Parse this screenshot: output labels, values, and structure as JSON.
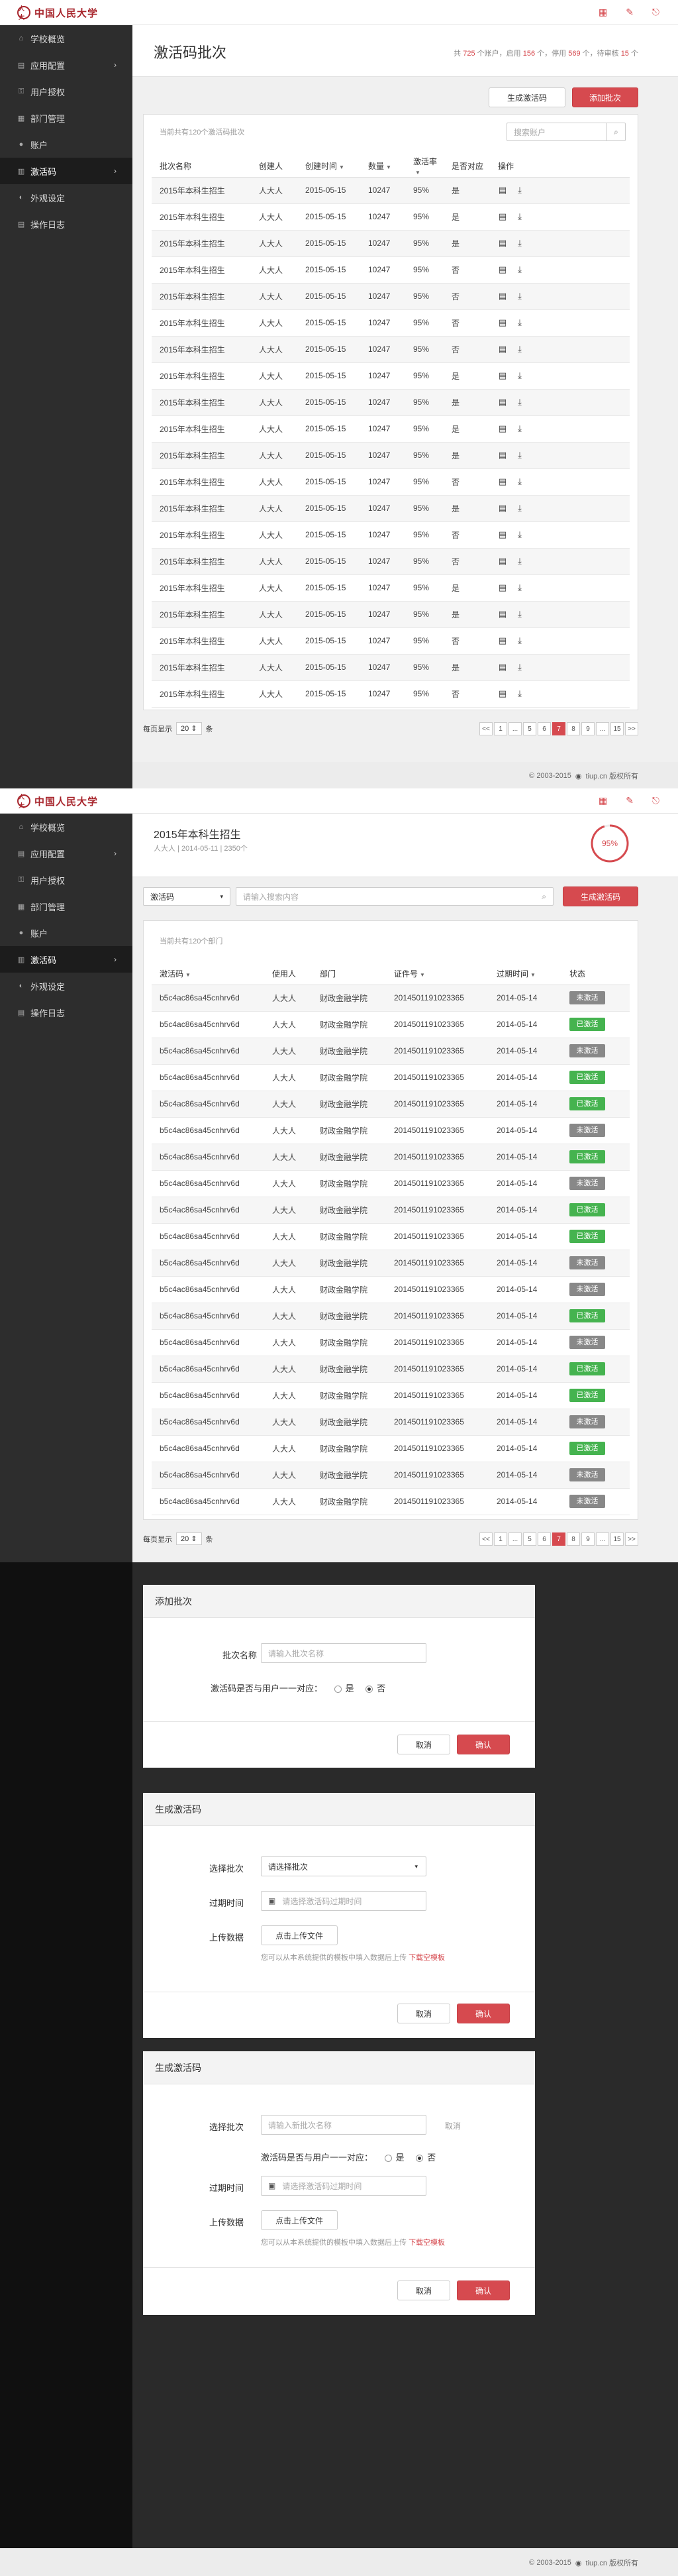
{
  "brand": {
    "seal": "人大",
    "name": "中国人民大学"
  },
  "header_icons": [
    "grid-icon",
    "user-icon",
    "logout-icon"
  ],
  "sidebar": {
    "items": [
      {
        "label": "学校概览",
        "icon": "home-icon"
      },
      {
        "label": "应用配置",
        "icon": "app-icon",
        "chev": "›"
      },
      {
        "label": "用户授权",
        "icon": "key-icon"
      },
      {
        "label": "部门管理",
        "icon": "org-icon"
      },
      {
        "label": "账户",
        "icon": "account-icon"
      },
      {
        "label": "激活码",
        "icon": "code-icon",
        "chev": "›",
        "active": true
      },
      {
        "label": "外观设定",
        "icon": "appearance-icon"
      },
      {
        "label": "操作日志",
        "icon": "log-icon"
      }
    ]
  },
  "page1": {
    "title": "激活码批次",
    "stats": {
      "p1": "共",
      "n1": "725",
      "p2": "个账户，启用",
      "n2": "156",
      "p3": "个，停用",
      "n3": "569",
      "p4": "个，待审核",
      "n4": "15",
      "p5": "个"
    },
    "btn_generate": "生成激活码",
    "btn_add": "添加批次",
    "summary": "当前共有120个激活码批次",
    "search_placeholder": "搜索账户",
    "columns": [
      "批次名称",
      "创建人",
      "创建时间",
      "数量",
      "激活率",
      "是否对应",
      "操作"
    ],
    "rows": [
      [
        "2015年本科生招生",
        "人大人",
        "2015-05-15",
        "10247",
        "95%",
        "是"
      ],
      [
        "2015年本科生招生",
        "人大人",
        "2015-05-15",
        "10247",
        "95%",
        "是"
      ],
      [
        "2015年本科生招生",
        "人大人",
        "2015-05-15",
        "10247",
        "95%",
        "是"
      ],
      [
        "2015年本科生招生",
        "人大人",
        "2015-05-15",
        "10247",
        "95%",
        "否"
      ],
      [
        "2015年本科生招生",
        "人大人",
        "2015-05-15",
        "10247",
        "95%",
        "否"
      ],
      [
        "2015年本科生招生",
        "人大人",
        "2015-05-15",
        "10247",
        "95%",
        "否"
      ],
      [
        "2015年本科生招生",
        "人大人",
        "2015-05-15",
        "10247",
        "95%",
        "否"
      ],
      [
        "2015年本科生招生",
        "人大人",
        "2015-05-15",
        "10247",
        "95%",
        "是"
      ],
      [
        "2015年本科生招生",
        "人大人",
        "2015-05-15",
        "10247",
        "95%",
        "是"
      ],
      [
        "2015年本科生招生",
        "人大人",
        "2015-05-15",
        "10247",
        "95%",
        "是"
      ],
      [
        "2015年本科生招生",
        "人大人",
        "2015-05-15",
        "10247",
        "95%",
        "是"
      ],
      [
        "2015年本科生招生",
        "人大人",
        "2015-05-15",
        "10247",
        "95%",
        "否"
      ],
      [
        "2015年本科生招生",
        "人大人",
        "2015-05-15",
        "10247",
        "95%",
        "是"
      ],
      [
        "2015年本科生招生",
        "人大人",
        "2015-05-15",
        "10247",
        "95%",
        "否"
      ],
      [
        "2015年本科生招生",
        "人大人",
        "2015-05-15",
        "10247",
        "95%",
        "否"
      ],
      [
        "2015年本科生招生",
        "人大人",
        "2015-05-15",
        "10247",
        "95%",
        "是"
      ],
      [
        "2015年本科生招生",
        "人大人",
        "2015-05-15",
        "10247",
        "95%",
        "是"
      ],
      [
        "2015年本科生招生",
        "人大人",
        "2015-05-15",
        "10247",
        "95%",
        "否"
      ],
      [
        "2015年本科生招生",
        "人大人",
        "2015-05-15",
        "10247",
        "95%",
        "是"
      ],
      [
        "2015年本科生招生",
        "人大人",
        "2015-05-15",
        "10247",
        "95%",
        "否"
      ]
    ],
    "per_page_label": "每页显示",
    "per_page_value": "20",
    "per_page_unit": "条",
    "pages": [
      "<<",
      "1",
      "...",
      "5",
      "6",
      "7",
      "8",
      "9",
      "...",
      "15",
      ">>"
    ],
    "current_page": "7"
  },
  "footer_text": "© 2003-2015",
  "footer_brand": "tiup.cn 版权所有",
  "page2": {
    "title": "2015年本科生招生",
    "meta": "人大人 | 2014-05-11 | 2350个",
    "rate": "95%",
    "rate_value": 0.95,
    "filter_select": "激活码",
    "search_placeholder": "请输入搜索内容",
    "btn_generate": "生成激活码",
    "summary": "当前共有120个部门",
    "columns": [
      "激活码",
      "使用人",
      "部门",
      "证件号",
      "过期时间",
      "状态"
    ],
    "rows": [
      [
        "b5c4ac86sa45cnhrv6d",
        "人大人",
        "财政金融学院",
        "20145011910233​65",
        "2014-05-14",
        "未激活"
      ],
      [
        "b5c4ac86sa45cnhrv6d",
        "人大人",
        "财政金融学院",
        "20145011910233​65",
        "2014-05-14",
        "已激活"
      ],
      [
        "b5c4ac86sa45cnhrv6d",
        "人大人",
        "财政金融学院",
        "20145011910233​65",
        "2014-05-14",
        "未激活"
      ],
      [
        "b5c4ac86sa45cnhrv6d",
        "人大人",
        "财政金融学院",
        "20145011910233​65",
        "2014-05-14",
        "已激活"
      ],
      [
        "b5c4ac86sa45cnhrv6d",
        "人大人",
        "财政金融学院",
        "20145011910233​65",
        "2014-05-14",
        "已激活"
      ],
      [
        "b5c4ac86sa45cnhrv6d",
        "人大人",
        "财政金融学院",
        "20145011910233​65",
        "2014-05-14",
        "未激活"
      ],
      [
        "b5c4ac86sa45cnhrv6d",
        "人大人",
        "财政金融学院",
        "20145011910233​65",
        "2014-05-14",
        "已激活"
      ],
      [
        "b5c4ac86sa45cnhrv6d",
        "人大人",
        "财政金融学院",
        "20145011910233​65",
        "2014-05-14",
        "未激活"
      ],
      [
        "b5c4ac86sa45cnhrv6d",
        "人大人",
        "财政金融学院",
        "20145011910233​65",
        "2014-05-14",
        "已激活"
      ],
      [
        "b5c4ac86sa45cnhrv6d",
        "人大人",
        "财政金融学院",
        "20145011910233​65",
        "2014-05-14",
        "已激活"
      ],
      [
        "b5c4ac86sa45cnhrv6d",
        "人大人",
        "财政金融学院",
        "20145011910233​65",
        "2014-05-14",
        "未激活"
      ],
      [
        "b5c4ac86sa45cnhrv6d",
        "人大人",
        "财政金融学院",
        "20145011910233​65",
        "2014-05-14",
        "未激活"
      ],
      [
        "b5c4ac86sa45cnhrv6d",
        "人大人",
        "财政金融学院",
        "20145011910233​65",
        "2014-05-14",
        "已激活"
      ],
      [
        "b5c4ac86sa45cnhrv6d",
        "人大人",
        "财政金融学院",
        "20145011910233​65",
        "2014-05-14",
        "未激活"
      ],
      [
        "b5c4ac86sa45cnhrv6d",
        "人大人",
        "财政金融学院",
        "20145011910233​65",
        "2014-05-14",
        "已激活"
      ],
      [
        "b5c4ac86sa45cnhrv6d",
        "人大人",
        "财政金融学院",
        "20145011910233​65",
        "2014-05-14",
        "已激活"
      ],
      [
        "b5c4ac86sa45cnhrv6d",
        "人大人",
        "财政金融学院",
        "20145011910233​65",
        "2014-05-14",
        "未激活"
      ],
      [
        "b5c4ac86sa45cnhrv6d",
        "人大人",
        "财政金融学院",
        "20145011910233​65",
        "2014-05-14",
        "已激活"
      ],
      [
        "b5c4ac86sa45cnhrv6d",
        "人大人",
        "财政金融学院",
        "20145011910233​65",
        "2014-05-14",
        "未激活"
      ],
      [
        "b5c4ac86sa45cnhrv6d",
        "人大人",
        "财政金融学院",
        "20145011910233​65",
        "2014-05-14",
        "未激活"
      ]
    ],
    "per_page_label": "每页显示",
    "per_page_value": "20",
    "per_page_unit": "条",
    "pages": [
      "<<",
      "1",
      "...",
      "5",
      "6",
      "7",
      "8",
      "9",
      "...",
      "15",
      ">>"
    ],
    "current_page": "7"
  },
  "modal_add": {
    "title": "添加批次",
    "name_label": "批次名称",
    "name_placeholder": "请输入批次名称",
    "map_label": "激活码是否与用户一一对应：",
    "yes": "是",
    "no": "否",
    "cancel": "取消",
    "confirm": "确认"
  },
  "modal_gen1": {
    "title": "生成激活码",
    "batch_label": "选择批次",
    "batch_placeholder": "请选择批次",
    "expire_label": "过期时间",
    "expire_placeholder": "请选择激活码过期时间",
    "upload_label": "上传数据",
    "upload_btn": "点击上传文件",
    "hint": "您可以从本系统提供的模板中填入数据后上传",
    "hint_link": "下载空模板",
    "cancel": "取消",
    "confirm": "确认"
  },
  "modal_gen2": {
    "title": "生成激活码",
    "batch_label": "选择批次",
    "batch_placeholder": "请输入新批次名称",
    "batch_cancel": "取消",
    "map_label": "激活码是否与用户一一对应：",
    "yes": "是",
    "no": "否",
    "expire_label": "过期时间",
    "expire_placeholder": "请选择激活码过期时间",
    "upload_label": "上传数据",
    "upload_btn": "点击上传文件",
    "hint": "您可以从本系统提供的模板中填入数据后上传",
    "hint_link": "下载空模板",
    "cancel": "取消",
    "confirm": "确认"
  }
}
